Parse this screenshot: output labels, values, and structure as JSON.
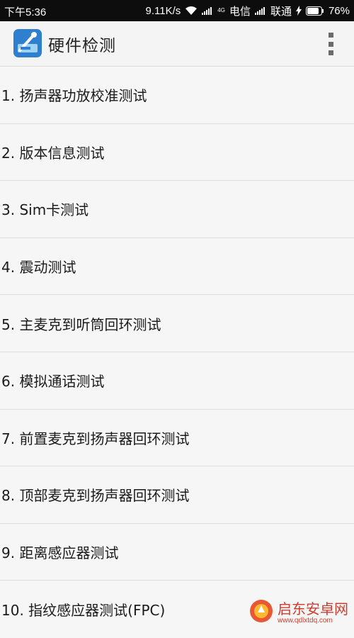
{
  "status_bar": {
    "time": "下午5:36",
    "speed": "9.11K/s",
    "net_type": "4G",
    "carrier1": "电信",
    "carrier2": "联通",
    "battery": "76%"
  },
  "app_bar": {
    "title": "硬件检测",
    "app_icon": "hardware-test-icon",
    "menu_icon": "overflow-menu-icon"
  },
  "items": [
    {
      "label": "1. 扬声器功放校准测试"
    },
    {
      "label": "2. 版本信息测试"
    },
    {
      "label": "3. Sim卡测试"
    },
    {
      "label": "4. 震动测试"
    },
    {
      "label": "5. 主麦克到听筒回环测试"
    },
    {
      "label": "6. 模拟通话测试"
    },
    {
      "label": "7. 前置麦克到扬声器回环测试"
    },
    {
      "label": "8. 顶部麦克到扬声器回环测试"
    },
    {
      "label": "9. 距离感应器测试"
    },
    {
      "label": "10. 指纹感应器测试(FPC)"
    }
  ],
  "watermark": {
    "main": "启东安卓网",
    "sub": "www.qdlxtdq.com"
  },
  "colors": {
    "status_bg": "#0d0d0d",
    "appbar_bg": "#f4f4f4",
    "list_bg": "#f6f6f6",
    "divider": "#dcdcdc",
    "battery_accent": "#ffffff",
    "watermark": "#cc2a1a"
  }
}
